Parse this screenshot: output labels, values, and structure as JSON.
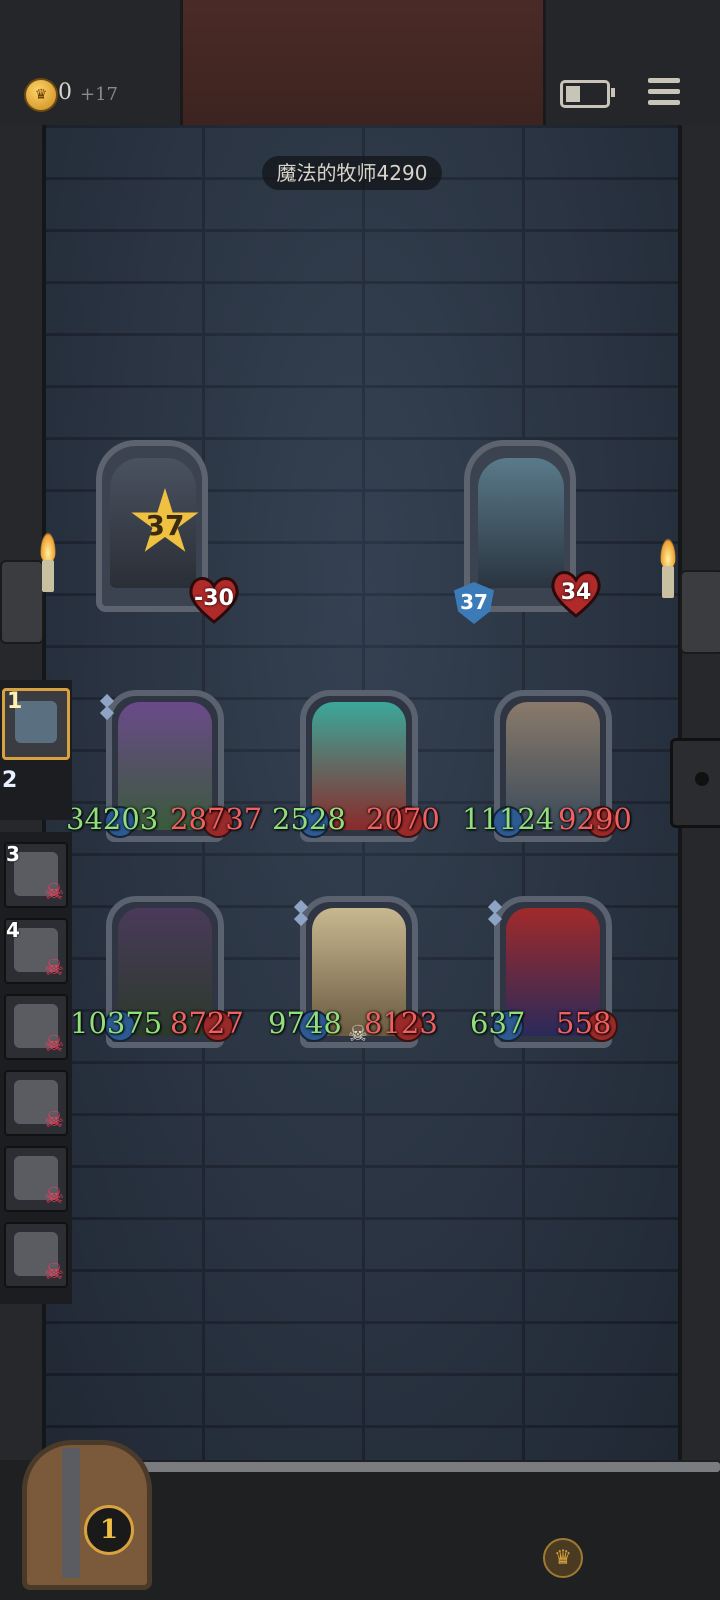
{
  "header": {
    "coins": "0",
    "coin_gain": "+17",
    "coin_icon": "crown-coin-icon",
    "battery_icon": "battery-icon",
    "menu_icon": "menu-icon"
  },
  "room": {
    "title": "魔法的牧师4290"
  },
  "enemies": [
    {
      "name_icon": "armored-miner-enemy",
      "level": "37",
      "hp": "-30"
    },
    {
      "name_icon": "top-hat-gentleman-enemy",
      "armor": "37",
      "hp": "34"
    }
  ],
  "heroes_row1": [
    {
      "atk": "34203",
      "hp": "28737"
    },
    {
      "atk": "2528",
      "hp": "2070"
    },
    {
      "atk": "11124",
      "hp": "9290"
    }
  ],
  "heroes_row2": [
    {
      "atk": "10375",
      "hp": "8727"
    },
    {
      "atk": "9748",
      "hp": "8123"
    },
    {
      "atk": "637",
      "hp": "558"
    }
  ],
  "sidebar": {
    "active_num": "1",
    "slot2": "2",
    "slot3": "3",
    "slot4": "4"
  },
  "deck": {
    "count": "1"
  },
  "colors": {
    "atk": "#8fe07a",
    "hp": "#f06060",
    "accent": "#d8a240"
  }
}
